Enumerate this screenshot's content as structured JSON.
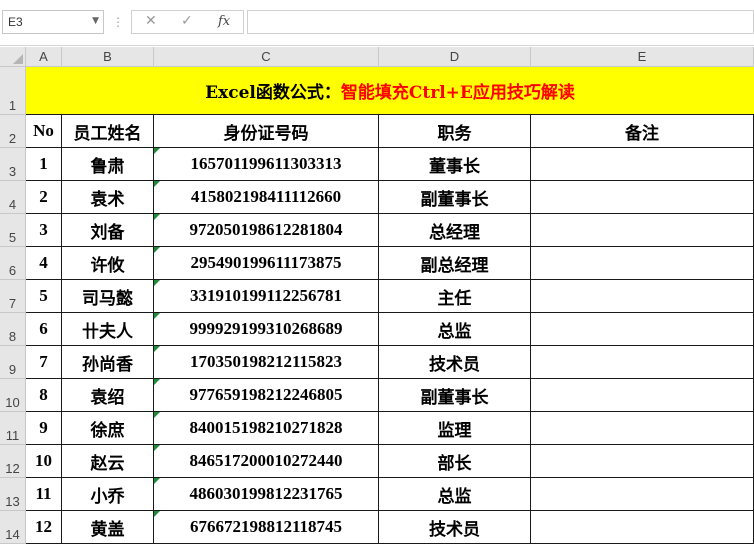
{
  "formula_bar": {
    "name_box": "E3",
    "cancel_glyph": "✕",
    "enter_glyph": "✓",
    "fx_label": "fx",
    "formula_value": ""
  },
  "columns": [
    "A",
    "B",
    "C",
    "D",
    "E"
  ],
  "rows": [
    "1",
    "2",
    "3",
    "4",
    "5",
    "6",
    "7",
    "8",
    "9",
    "10",
    "11",
    "12",
    "13",
    "14"
  ],
  "sheet": {
    "title_part1": "Excel函数公式：",
    "title_part2": "智能填充Ctrl+E应用技巧解读",
    "title_fill": "#ffff00",
    "title_accent": "#ff0000",
    "headers": [
      "No",
      "员工姓名",
      "身份证号码",
      "职务",
      "备注"
    ],
    "records": [
      {
        "no": "1",
        "name": "鲁肃",
        "id": "165701199611303313",
        "job": "董事长",
        "note": ""
      },
      {
        "no": "2",
        "name": "袁术",
        "id": "415802198411112660",
        "job": "副董事长",
        "note": ""
      },
      {
        "no": "3",
        "name": "刘备",
        "id": "972050198612281804",
        "job": "总经理",
        "note": ""
      },
      {
        "no": "4",
        "name": "许攸",
        "id": "295490199611173875",
        "job": "副总经理",
        "note": ""
      },
      {
        "no": "5",
        "name": "司马懿",
        "id": "331910199112256781",
        "job": "主任",
        "note": ""
      },
      {
        "no": "6",
        "name": "卄夫人",
        "id": "999929199310268689",
        "job": "总监",
        "note": ""
      },
      {
        "no": "7",
        "name": "孙尚香",
        "id": "170350198212115823",
        "job": "技术员",
        "note": ""
      },
      {
        "no": "8",
        "name": "袁绍",
        "id": "977659198212246805",
        "job": "副董事长",
        "note": ""
      },
      {
        "no": "9",
        "name": "徐庶",
        "id": "840015198210271828",
        "job": "监理",
        "note": ""
      },
      {
        "no": "10",
        "name": "赵云",
        "id": "846517200010272440",
        "job": "部长",
        "note": ""
      },
      {
        "no": "11",
        "name": "小乔",
        "id": "486030199812231765",
        "job": "总监",
        "note": ""
      },
      {
        "no": "12",
        "name": "黄盖",
        "id": "676672198812118745",
        "job": "技术员",
        "note": ""
      }
    ]
  }
}
